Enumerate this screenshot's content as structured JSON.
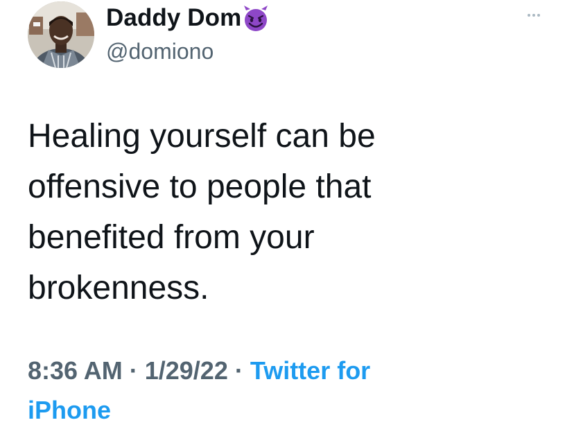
{
  "author": {
    "display_name": "Daddy Dom",
    "emoji_icon": "smiling-devil-emoji",
    "handle": "@domiono",
    "avatar_icon": "profile-photo"
  },
  "tweet": {
    "text_lines": [
      "Healing yourself can be",
      "offensive to people that",
      "benefited from your",
      "brokenness."
    ]
  },
  "meta": {
    "time": "8:36 AM",
    "separator": "·",
    "date": "1/29/22",
    "source_line1": "Twitter for",
    "source_line2": "iPhone"
  },
  "menu": {
    "more_icon": "more-options-icon"
  },
  "colors": {
    "text": "#0f1419",
    "secondary": "#536471",
    "link": "#1d9bf0",
    "emoji_purple": "#8e47c7"
  }
}
